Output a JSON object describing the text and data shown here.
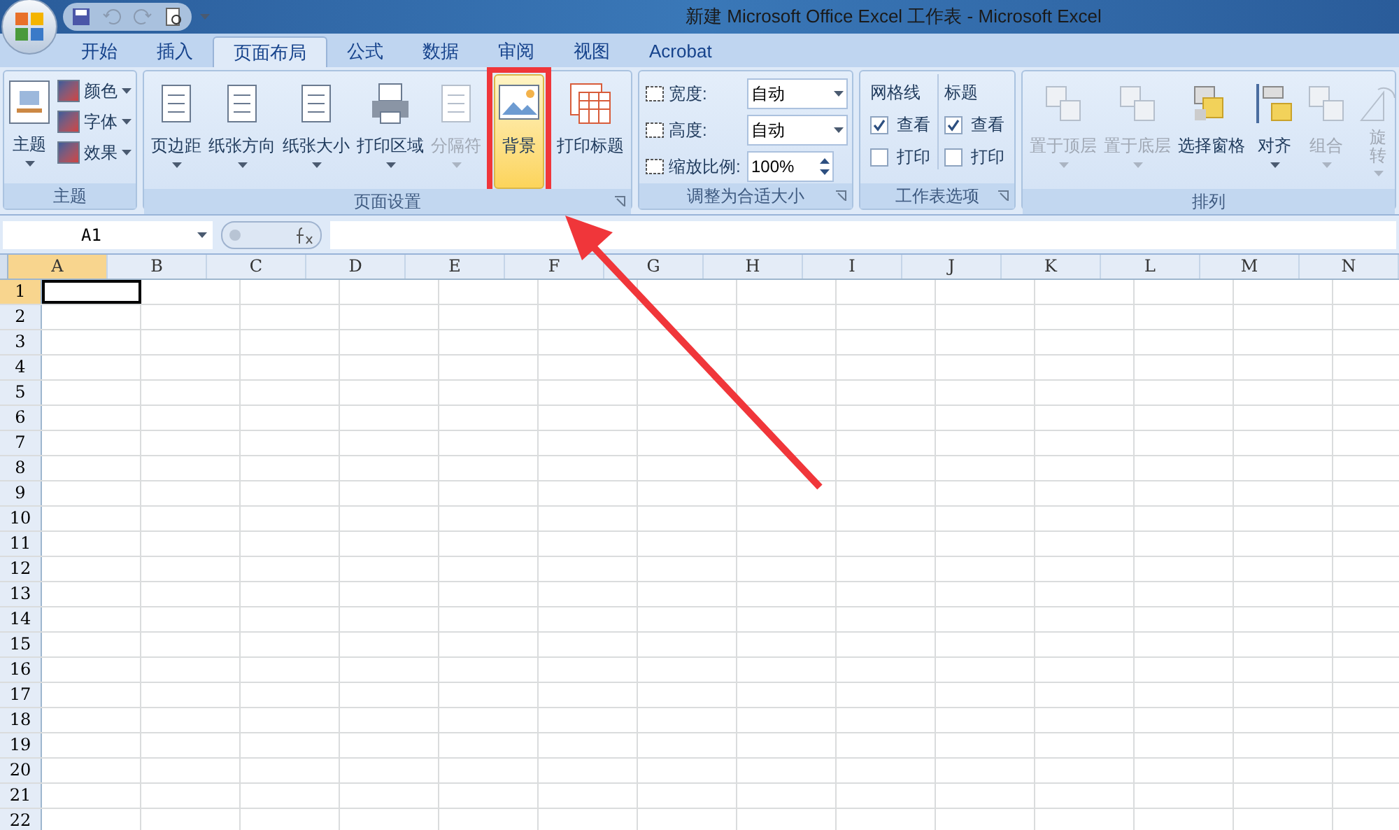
{
  "window": {
    "title": "新建 Microsoft Office Excel 工作表 - Microsoft Excel"
  },
  "tabs": [
    {
      "label": "开始",
      "selected": false
    },
    {
      "label": "插入",
      "selected": false
    },
    {
      "label": "页面布局",
      "selected": true
    },
    {
      "label": "公式",
      "selected": false
    },
    {
      "label": "数据",
      "selected": false
    },
    {
      "label": "审阅",
      "selected": false
    },
    {
      "label": "视图",
      "selected": false
    },
    {
      "label": "Acrobat",
      "selected": false
    }
  ],
  "ribbon": {
    "theme_group": {
      "label": "主题",
      "big_button": {
        "label": "主题"
      },
      "items": [
        {
          "label": "颜色"
        },
        {
          "label": "字体"
        },
        {
          "label": "效果"
        }
      ]
    },
    "page_setup_group": {
      "label": "页面设置",
      "buttons": [
        {
          "label": "页边距",
          "caret": true,
          "disabled": false,
          "highlighted": false
        },
        {
          "label": "纸张方向",
          "caret": true,
          "disabled": false,
          "highlighted": false
        },
        {
          "label": "纸张大小",
          "caret": true,
          "disabled": false,
          "highlighted": false
        },
        {
          "label": "打印区域",
          "caret": true,
          "disabled": false,
          "highlighted": false
        },
        {
          "label": "分隔符",
          "caret": true,
          "disabled": true,
          "highlighted": false
        },
        {
          "label": "背景",
          "caret": false,
          "disabled": false,
          "highlighted": true
        },
        {
          "label": "打印标题",
          "caret": false,
          "disabled": false,
          "highlighted": false
        }
      ]
    },
    "scale_group": {
      "label": "调整为合适大小",
      "rows": [
        {
          "label": "宽度:",
          "value": "自动",
          "kind": "dropdown"
        },
        {
          "label": "高度:",
          "value": "自动",
          "kind": "dropdown"
        },
        {
          "label": "缩放比例:",
          "value": "100%",
          "kind": "spinner"
        }
      ]
    },
    "sheet_options_group": {
      "label": "工作表选项",
      "columns": [
        {
          "heading": "网格线",
          "options": [
            {
              "label": "查看",
              "checked": true
            },
            {
              "label": "打印",
              "checked": false
            }
          ]
        },
        {
          "heading": "标题",
          "options": [
            {
              "label": "查看",
              "checked": true
            },
            {
              "label": "打印",
              "checked": false
            }
          ]
        }
      ]
    },
    "arrange_group": {
      "label": "排列",
      "buttons": [
        {
          "label": "置于顶层",
          "caret": true,
          "disabled": true
        },
        {
          "label": "置于底层",
          "caret": true,
          "disabled": true
        },
        {
          "label": "选择窗格",
          "caret": false,
          "disabled": false
        },
        {
          "label": "对齐",
          "caret": true,
          "disabled": false
        },
        {
          "label": "组合",
          "caret": true,
          "disabled": true
        },
        {
          "label": "旋转",
          "caret": true,
          "disabled": true
        }
      ]
    }
  },
  "formula_bar": {
    "name_box": "A1"
  },
  "sheet": {
    "columns": [
      {
        "label": "A",
        "selected": true
      },
      {
        "label": "B",
        "selected": false
      },
      {
        "label": "C",
        "selected": false
      },
      {
        "label": "D",
        "selected": false
      },
      {
        "label": "E",
        "selected": false
      },
      {
        "label": "F",
        "selected": false
      },
      {
        "label": "G",
        "selected": false
      },
      {
        "label": "H",
        "selected": false
      },
      {
        "label": "I",
        "selected": false
      },
      {
        "label": "J",
        "selected": false
      },
      {
        "label": "K",
        "selected": false
      },
      {
        "label": "L",
        "selected": false
      },
      {
        "label": "M",
        "selected": false
      },
      {
        "label": "N",
        "selected": false
      }
    ],
    "rows": [
      {
        "label": "1",
        "selected": true
      },
      {
        "label": "2",
        "selected": false
      },
      {
        "label": "3",
        "selected": false
      },
      {
        "label": "4",
        "selected": false
      },
      {
        "label": "5",
        "selected": false
      },
      {
        "label": "6",
        "selected": false
      },
      {
        "label": "7",
        "selected": false
      },
      {
        "label": "8",
        "selected": false
      },
      {
        "label": "9",
        "selected": false
      },
      {
        "label": "10",
        "selected": false
      },
      {
        "label": "11",
        "selected": false
      },
      {
        "label": "12",
        "selected": false
      },
      {
        "label": "13",
        "selected": false
      },
      {
        "label": "14",
        "selected": false
      },
      {
        "label": "15",
        "selected": false
      },
      {
        "label": "16",
        "selected": false
      },
      {
        "label": "17",
        "selected": false
      },
      {
        "label": "18",
        "selected": false
      },
      {
        "label": "19",
        "selected": false
      },
      {
        "label": "20",
        "selected": false
      },
      {
        "label": "21",
        "selected": false
      },
      {
        "label": "22",
        "selected": false
      }
    ]
  }
}
